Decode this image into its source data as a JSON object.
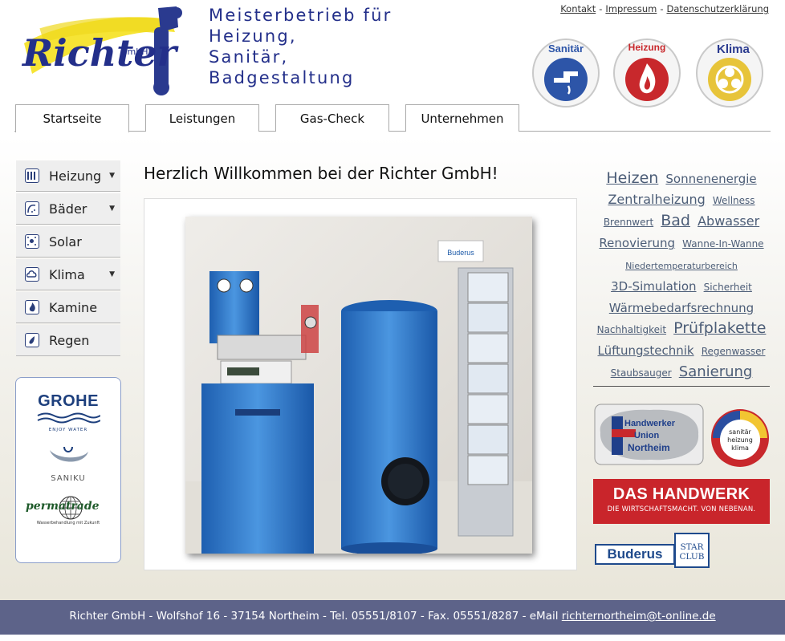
{
  "header": {
    "logo_text": "Richter",
    "logo_sub": "GmbH",
    "tagline": [
      "Meisterbetrieb für",
      "Heizung,",
      "Sanitär,",
      "Badgestaltung"
    ],
    "top_links": [
      "Kontakt",
      "Impressum",
      "Datenschutzerklärung"
    ],
    "badges": [
      {
        "label": "Sanitär",
        "icon": "faucet-icon",
        "color": "#2d55a8"
      },
      {
        "label": "Heizung",
        "icon": "flame-icon",
        "color": "#c8282c"
      },
      {
        "label": "Klima",
        "icon": "fan-icon",
        "color": "#e7c43a"
      }
    ]
  },
  "tabs": [
    {
      "label": "Startseite",
      "active": true
    },
    {
      "label": "Leistungen",
      "active": false
    },
    {
      "label": "Gas-Check",
      "active": false
    },
    {
      "label": "Unternehmen",
      "active": false
    }
  ],
  "sidebar": {
    "items": [
      {
        "label": "Heizung",
        "icon": "radiator-icon",
        "has_submenu": true
      },
      {
        "label": "Bäder",
        "icon": "shower-icon",
        "has_submenu": true
      },
      {
        "label": "Solar",
        "icon": "sun-icon",
        "has_submenu": false
      },
      {
        "label": "Klima",
        "icon": "cloud-icon",
        "has_submenu": true
      },
      {
        "label": "Kamine",
        "icon": "flame-icon",
        "has_submenu": false
      },
      {
        "label": "Regen",
        "icon": "raindrop-icon",
        "has_submenu": false
      }
    ],
    "brands": {
      "grohe": "GROHE",
      "grohe_tagline": "ENJOY WATER",
      "saniku": "SANIKU",
      "permatrade": "permatrade",
      "permatrade_tagline": "Wasserbehandlung mit Zukunft"
    }
  },
  "main": {
    "welcome": "Herzlich Willkommen bei der Richter GmbH!",
    "photo_brand_label": "Buderus"
  },
  "tag_cloud": [
    {
      "text": "Heizen",
      "size": 19
    },
    {
      "text": "Sonnenenergie",
      "size": 15
    },
    {
      "text": "Zentralheizung",
      "size": 16
    },
    {
      "text": "Wellness",
      "size": 12
    },
    {
      "text": "Brennwert",
      "size": 12
    },
    {
      "text": "Bad",
      "size": 19
    },
    {
      "text": "Abwasser",
      "size": 16
    },
    {
      "text": "Renovierung",
      "size": 15
    },
    {
      "text": "Wanne-In-Wanne",
      "size": 12
    },
    {
      "text": "Niedertemperaturbereich",
      "size": 11
    },
    {
      "text": "3D-Simulation",
      "size": 15
    },
    {
      "text": "Sicherheit",
      "size": 12
    },
    {
      "text": "Wärmebedarfsrechnung",
      "size": 15
    },
    {
      "text": "Nachhaltigkeit",
      "size": 12
    },
    {
      "text": "Prüfplakette",
      "size": 19
    },
    {
      "text": "Lüftungstechnik",
      "size": 15
    },
    {
      "text": "Regenwasser",
      "size": 12
    },
    {
      "text": "Staubsauger",
      "size": 12
    },
    {
      "text": "Sanierung",
      "size": 18
    }
  ],
  "partners": {
    "handwerker_union": [
      "Handwerker",
      "Union",
      "Northeim"
    ],
    "shk": [
      "sanitär",
      "heizung",
      "klima"
    ],
    "handwerk_main": "DAS HANDWERK",
    "handwerk_sub": "DIE WIRTSCHAFTSMACHT. VON NEBENAN.",
    "buderus": "Buderus",
    "buderus_star": [
      "STAR",
      "CLUB"
    ]
  },
  "footer": {
    "text": "Richter GmbH - Wolfshof 16 - 37154 Northeim - Tel. 05551/8107 - Fax. 05551/8287 - eMail ",
    "email": "richternortheim@t-online.de"
  }
}
